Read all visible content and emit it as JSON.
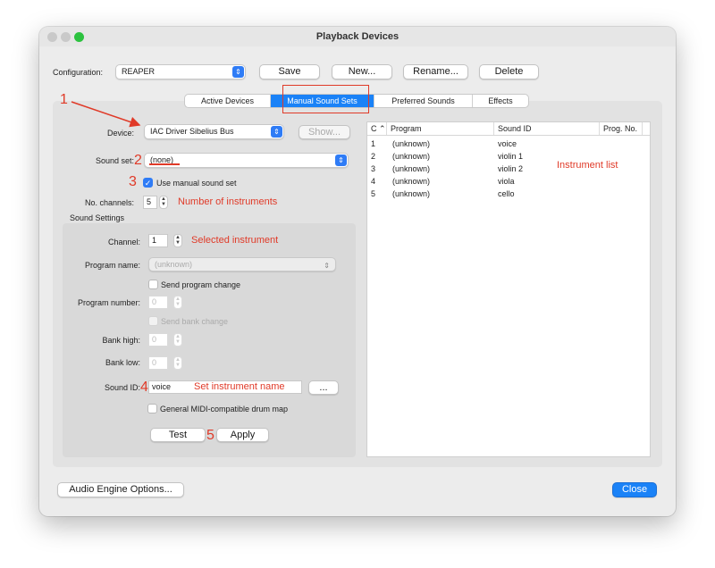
{
  "window": {
    "title": "Playback Devices"
  },
  "config": {
    "label": "Configuration:",
    "value": "REAPER",
    "save": "Save",
    "new": "New...",
    "rename": "Rename...",
    "delete": "Delete"
  },
  "tabs": [
    {
      "label": "Active Devices"
    },
    {
      "label": "Manual Sound Sets"
    },
    {
      "label": "Preferred Sounds"
    },
    {
      "label": "Effects"
    }
  ],
  "form": {
    "device_label": "Device:",
    "device_value": "IAC Driver Sibelius Bus",
    "show": "Show...",
    "soundset_label": "Sound set:",
    "soundset_value": "(none)",
    "use_manual": "Use manual sound set",
    "channels_label": "No. channels:",
    "channels_value": "5",
    "settings_title": "Sound Settings",
    "channel_label": "Channel:",
    "channel_value": "1",
    "program_name_label": "Program name:",
    "program_name_value": "(unknown)",
    "send_program_change": "Send program change",
    "program_number_label": "Program number:",
    "program_number_value": "0",
    "send_bank_change": "Send bank change",
    "bank_high_label": "Bank high:",
    "bank_high_value": "0",
    "bank_low_label": "Bank low:",
    "bank_low_value": "0",
    "sound_id_label": "Sound ID:",
    "sound_id_value": "voice",
    "browse": "...",
    "drum_map": "General MIDI-compatible drum map",
    "test": "Test",
    "apply": "Apply"
  },
  "table": {
    "headers": [
      "C",
      "Program",
      "Sound ID",
      "Prog. No."
    ],
    "rows": [
      [
        "1",
        "(unknown)",
        "voice"
      ],
      [
        "2",
        "(unknown)",
        "violin 1"
      ],
      [
        "3",
        "(unknown)",
        "violin 2"
      ],
      [
        "4",
        "(unknown)",
        "viola"
      ],
      [
        "5",
        "(unknown)",
        "cello"
      ]
    ]
  },
  "footer": {
    "audio_engine": "Audio Engine Options...",
    "close": "Close"
  },
  "annotations": {
    "n1": "1",
    "n2": "2",
    "n3": "3",
    "n4": "4",
    "n5": "5",
    "instruments": "Number of  instruments",
    "selected": "Selected instrument",
    "set_name": "Set instrument name",
    "list": "Instrument list"
  },
  "colors": {
    "accent": "#1a82f7",
    "annotation": "#e03a28"
  }
}
